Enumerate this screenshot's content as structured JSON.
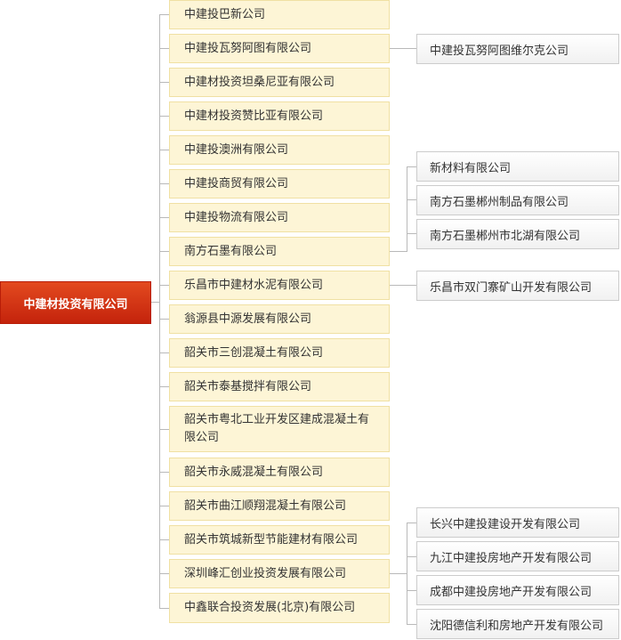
{
  "root": {
    "label": "中建材投资有限公司"
  },
  "companies": [
    {
      "name": "中建投巴新公司"
    },
    {
      "name": "中建投瓦努阿图有限公司"
    },
    {
      "name": "中建材投资坦桑尼亚有限公司"
    },
    {
      "name": "中建材投资赞比亚有限公司"
    },
    {
      "name": "中建投澳洲有限公司"
    },
    {
      "name": "中建投商贸有限公司"
    },
    {
      "name": "中建投物流有限公司"
    },
    {
      "name": "南方石墨有限公司"
    },
    {
      "name": "乐昌市中建材水泥有限公司"
    },
    {
      "name": "翁源县中源发展有限公司"
    },
    {
      "name": "韶关市三创混凝土有限公司"
    },
    {
      "name": "韶关市泰基搅拌有限公司"
    },
    {
      "name": "韶关市粤北工业开发区建成混凝土有限公司"
    },
    {
      "name": "韶关市永威混凝土有限公司"
    },
    {
      "name": "韶关市曲江顺翔混凝土有限公司"
    },
    {
      "name": "韶关市筑城新型节能建材有限公司"
    },
    {
      "name": "深圳峰汇创业投资发展有限公司"
    },
    {
      "name": "中鑫联合投资发展(北京)有限公司"
    }
  ],
  "subsidiaries": {
    "vanuatu": [
      {
        "name": "中建投瓦努阿图维尔克公司"
      }
    ],
    "graphite": [
      {
        "name": "新材料有限公司"
      },
      {
        "name": "南方石墨郴州制品有限公司"
      },
      {
        "name": "南方石墨郴州市北湖有限公司"
      }
    ],
    "lechang": [
      {
        "name": "乐昌市双门寨矿山开发有限公司"
      }
    ],
    "shenzhen": [
      {
        "name": "长兴中建投建设开发有限公司"
      },
      {
        "name": "九江中建投房地产开发有限公司"
      },
      {
        "name": "成都中建投房地产开发有限公司"
      },
      {
        "name": "沈阳德信利和房地产开发有限公司"
      }
    ]
  }
}
